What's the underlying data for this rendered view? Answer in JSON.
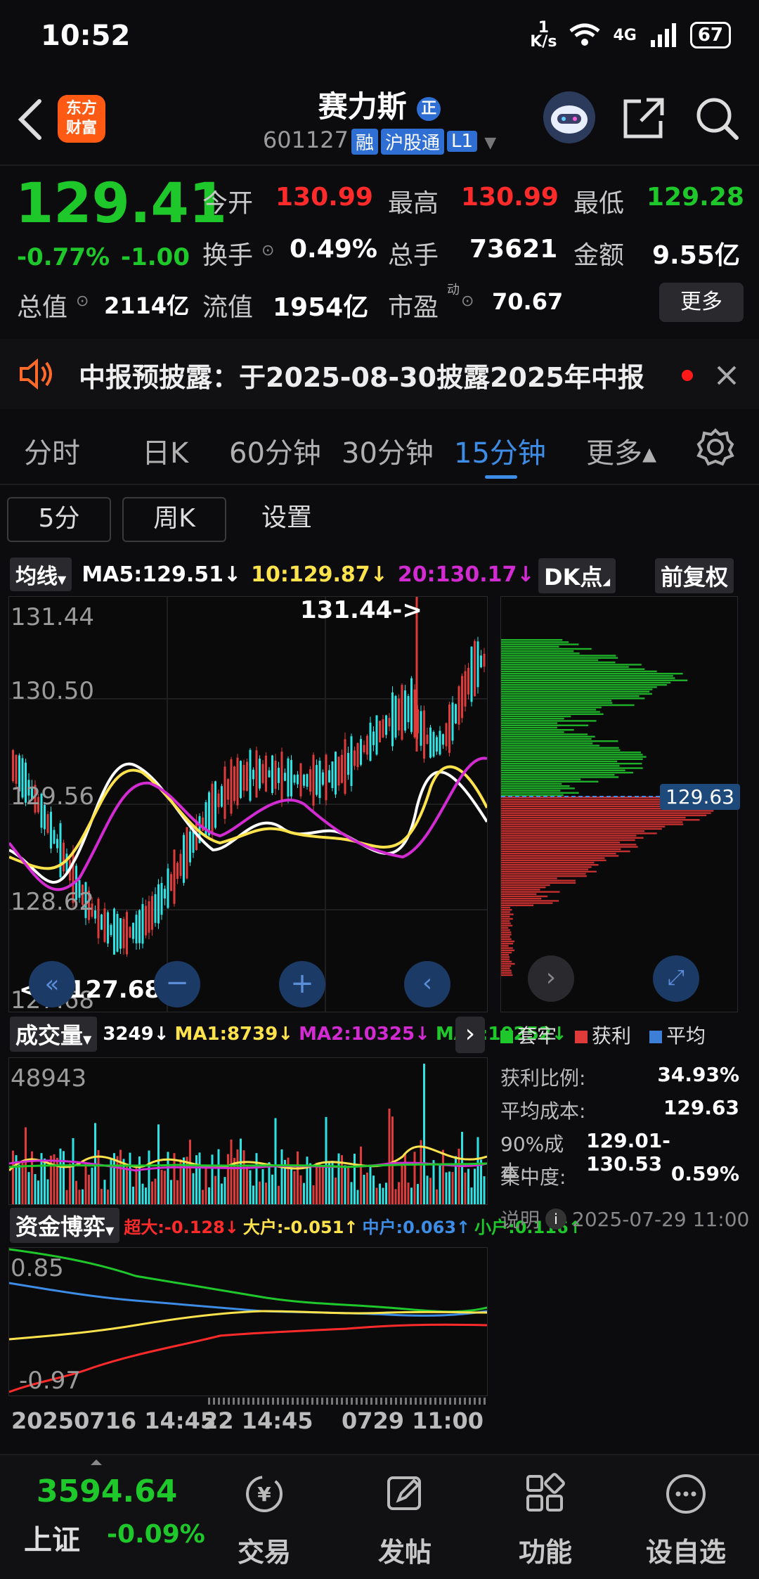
{
  "status": {
    "time": "10:52",
    "net_speed_top": "1",
    "net_speed_unit": "K/s",
    "network": "4G",
    "battery": "67"
  },
  "header": {
    "logo_line1": "东方",
    "logo_line2": "财富",
    "name": "赛力斯",
    "badge": "正",
    "code": "601127",
    "tag1": "融",
    "tag2": "沪股通",
    "tag3": "L1"
  },
  "quote": {
    "price": "129.41",
    "change_pct": "-0.77%",
    "change": "-1.00",
    "open_label": "今开",
    "open": "130.99",
    "high_label": "最高",
    "high": "130.99",
    "low_label": "最低",
    "low": "129.28",
    "turnover_label": "换手",
    "turnover": "0.49%",
    "volume_label": "总手",
    "volume": "73621",
    "amount_label": "金额",
    "amount": "9.55亿",
    "mcap_label": "总值",
    "mcap": "2114亿",
    "float_label": "流值",
    "float": "1954亿",
    "pe_label": "市盈",
    "pe_sup": "动",
    "pe": "70.67",
    "more": "更多"
  },
  "notice": {
    "text": "中报预披露：于2025-08-30披露2025年中报"
  },
  "tabs": [
    {
      "label": "分时"
    },
    {
      "label": "日K"
    },
    {
      "label": "60分钟"
    },
    {
      "label": "30分钟"
    },
    {
      "label": "15分钟"
    },
    {
      "label": "更多▴"
    }
  ],
  "subtabs": {
    "a": "5分",
    "b": "周K",
    "c": "设置"
  },
  "ma": {
    "select": "均线",
    "ma5": "MA5:129.51↓",
    "ma10": "10:129.87↓",
    "ma20": "20:130.17↓",
    "dk": "DK点",
    "fq": "前复权"
  },
  "kline": {
    "y_top": "131.44",
    "y2": "130.50",
    "y3": "129.56",
    "y4": "128.62",
    "y_bottom": "127.68",
    "max_note": "131.44->",
    "min_note": "<---127.68"
  },
  "chip": {
    "price_marker": "129.63",
    "legend_trap": "套牢",
    "legend_profit": "获利",
    "legend_avg": "平均",
    "rows": [
      {
        "k": "获利比例:",
        "v": "34.93%"
      },
      {
        "k": "平均成本:",
        "v": "129.63"
      },
      {
        "k": "90%成本:",
        "v": "129.01-130.53"
      },
      {
        "k": "集中度:",
        "v": "0.59%"
      }
    ],
    "note_label": "说明",
    "note_date": "2025-07-29 11:00"
  },
  "volume": {
    "select": "成交量",
    "v": "3249↓",
    "ma1": "MA1:8739↓",
    "ma2": "MA2:10325↓",
    "ma3": "MA3:10252↓",
    "top": "48943"
  },
  "fund": {
    "select": "资金博弈",
    "chao": "超大:-0.128↓",
    "da": "大户:-0.051↑",
    "zhong": "中户:0.063↑",
    "xiao": "小户:0.116↑",
    "top": "0.85",
    "bottom": "-0.97"
  },
  "time_axis": {
    "left": "20250716 14:45",
    "mid": "22 14:45",
    "right": "0729 11:00"
  },
  "bottom": {
    "index_value": "3594.64",
    "index_name": "上证",
    "index_change": "-0.09%",
    "trade": "交易",
    "post": "发帖",
    "func": "功能",
    "watch": "设自选"
  },
  "colors": {
    "up": "#ff2b2b",
    "down": "#1fc82a",
    "accent": "#3d8de6",
    "ma10": "#ffe34d",
    "ma20": "#d12bd1",
    "cyan": "#2ee3e3"
  }
}
